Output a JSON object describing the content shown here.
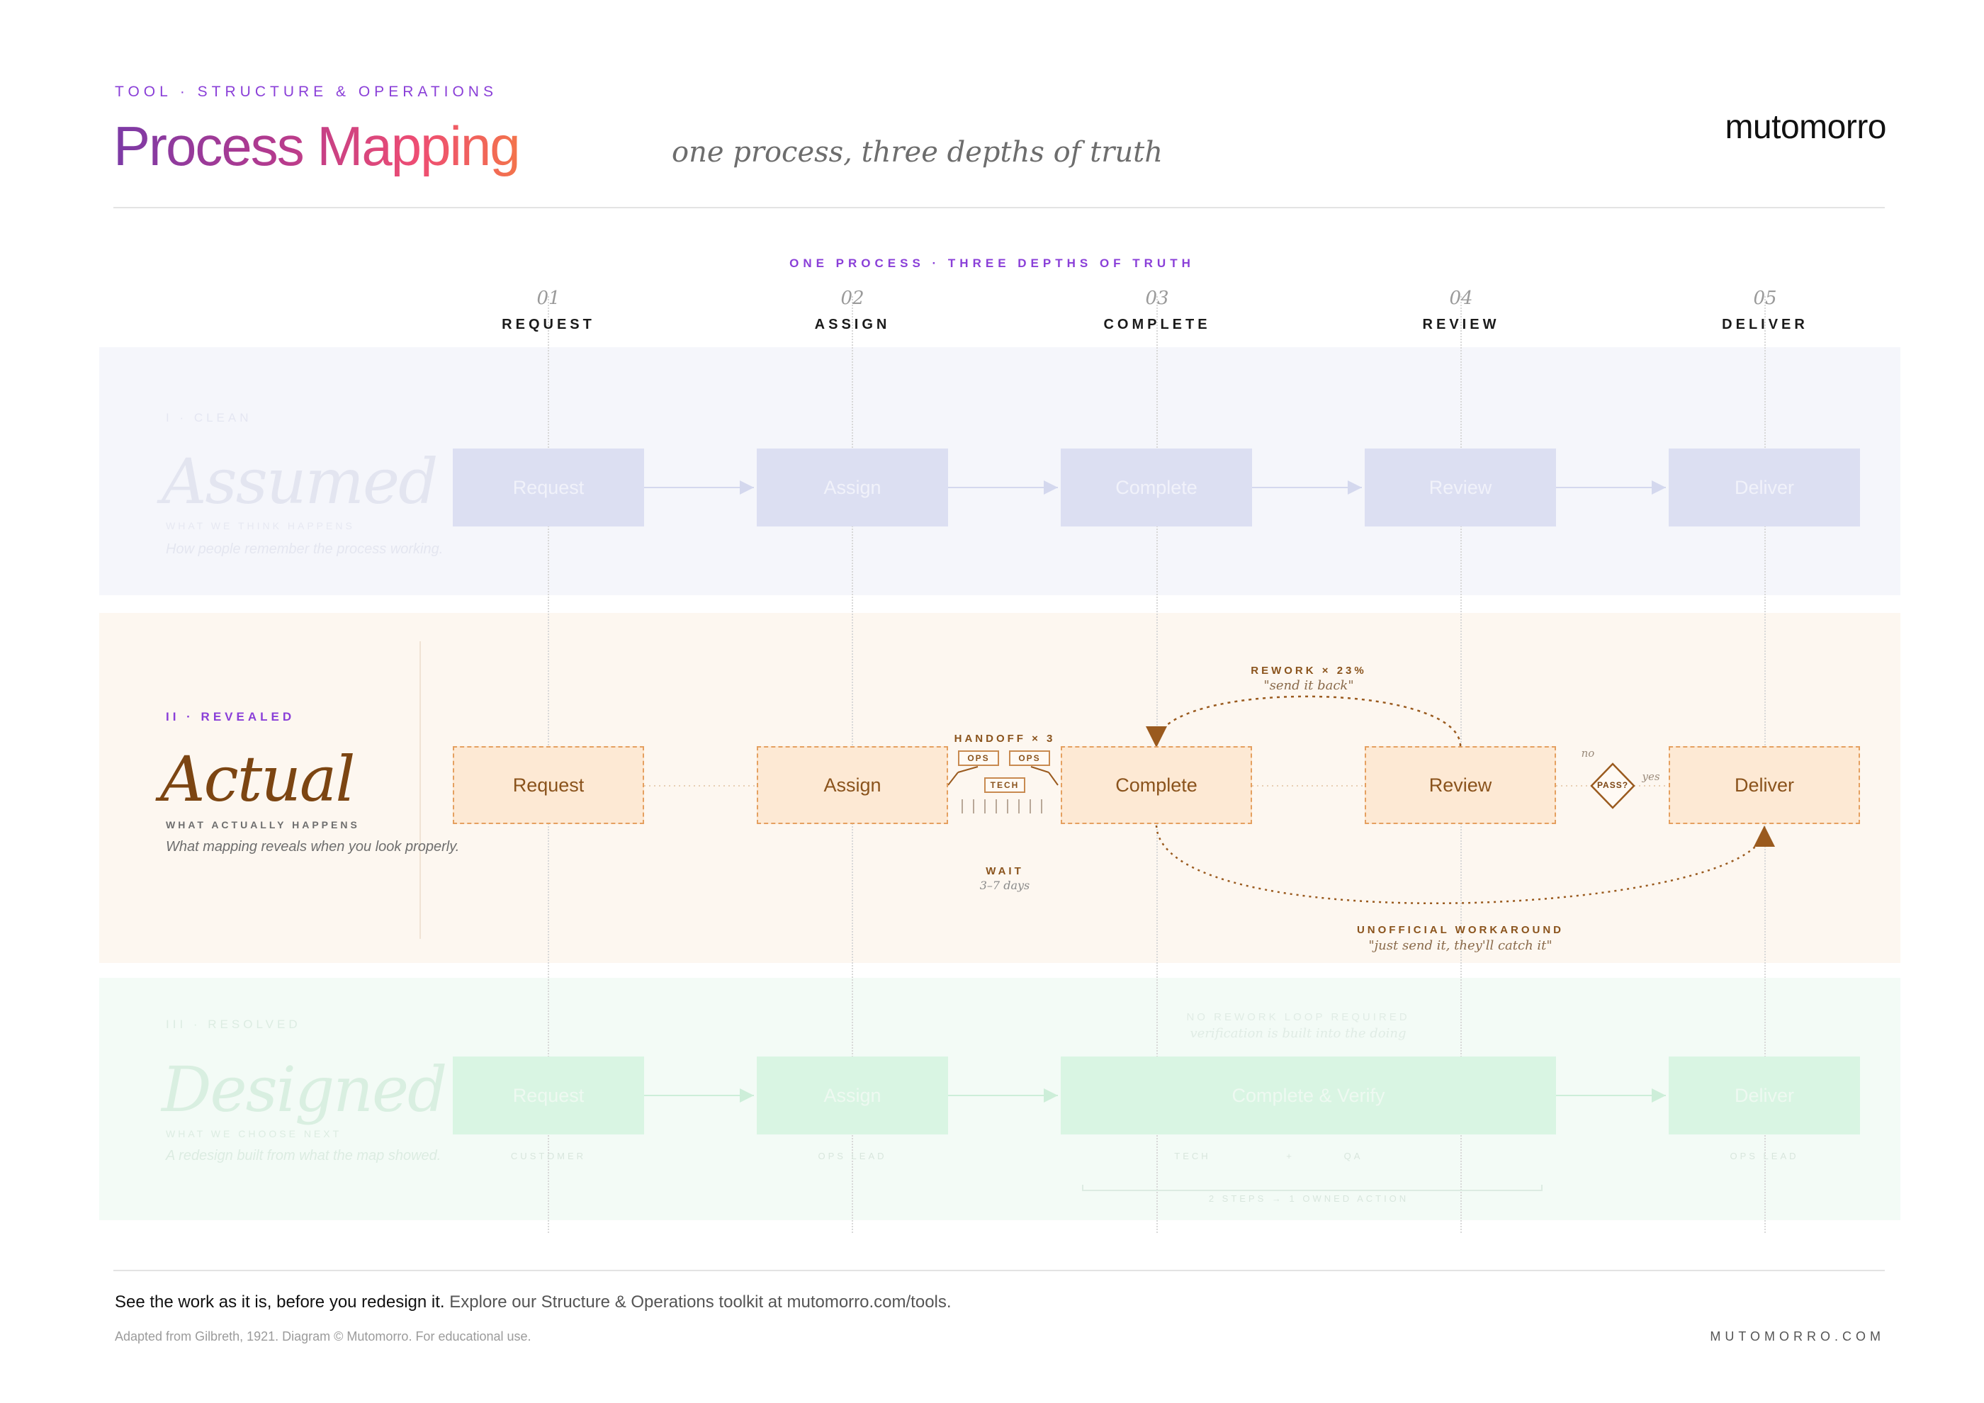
{
  "header": {
    "eyebrow": "TOOL · STRUCTURE & OPERATIONS",
    "title": "Process Mapping",
    "subtitle": "one process, three depths of truth",
    "brand": "mutomorro"
  },
  "diagram": {
    "label": "ONE PROCESS · THREE DEPTHS OF TRUTH",
    "columns": [
      {
        "num": "01",
        "name": "REQUEST"
      },
      {
        "num": "02",
        "name": "ASSIGN"
      },
      {
        "num": "03",
        "name": "COMPLETE"
      },
      {
        "num": "04",
        "name": "REVIEW"
      },
      {
        "num": "05",
        "name": "DELIVER"
      }
    ]
  },
  "lanes": {
    "assumed": {
      "eyebrow": "I · CLEAN",
      "title": "Assumed",
      "kicker": "WHAT WE THINK HAPPENS",
      "desc": "How people remember the process working.",
      "steps": [
        "Request",
        "Assign",
        "Complete",
        "Review",
        "Deliver"
      ]
    },
    "actual": {
      "eyebrow": "II · REVEALED",
      "title": "Actual",
      "kicker": "WHAT ACTUALLY HAPPENS",
      "desc": "What mapping reveals when you look properly.",
      "steps": [
        "Request",
        "Assign",
        "Complete",
        "Review",
        "Deliver"
      ],
      "handoff_label": "HANDOFF × 3",
      "handoff_tags": [
        "OPS",
        "OPS",
        "TECH"
      ],
      "wait_label": "WAIT",
      "wait_sub": "3–7 days",
      "rework_label": "REWORK × 23%",
      "rework_sub": "\"send it back\"",
      "decision_label": "PASS?",
      "decision_no": "no",
      "decision_yes": "yes",
      "workaround_label": "UNOFFICIAL WORKAROUND",
      "workaround_sub": "\"just send it, they'll catch it\""
    },
    "designed": {
      "eyebrow": "III · RESOLVED",
      "title": "Designed",
      "kicker": "WHAT WE CHOOSE NEXT",
      "desc": "A redesign built from what the map showed.",
      "steps": [
        "Request",
        "Assign",
        "Complete & Verify",
        "Deliver"
      ],
      "owners": [
        "CUSTOMER",
        "OPS LEAD",
        "TECH",
        "+",
        "QA",
        "OPS LEAD"
      ],
      "note_title": "NO REWORK LOOP REQUIRED",
      "note_sub": "verification is built into the doing",
      "merge_note": "2 STEPS → 1 OWNED ACTION"
    }
  },
  "footer": {
    "lead": "See the work as it is, before you redesign it.",
    "rest": "Explore our Structure & Operations toolkit at mutomorro.com/tools.",
    "credit": "Adapted from Gilbreth, 1921. Diagram © Mutomorro. For educational use.",
    "url": "MUTOMORRO.COM"
  },
  "colors": {
    "accent_purple": "#8a3fd8",
    "actual_brown": "#8a531c",
    "actual_border": "#e5a060",
    "assumed_box": "#dcdff2",
    "designed_box": "#d9f5e3"
  }
}
